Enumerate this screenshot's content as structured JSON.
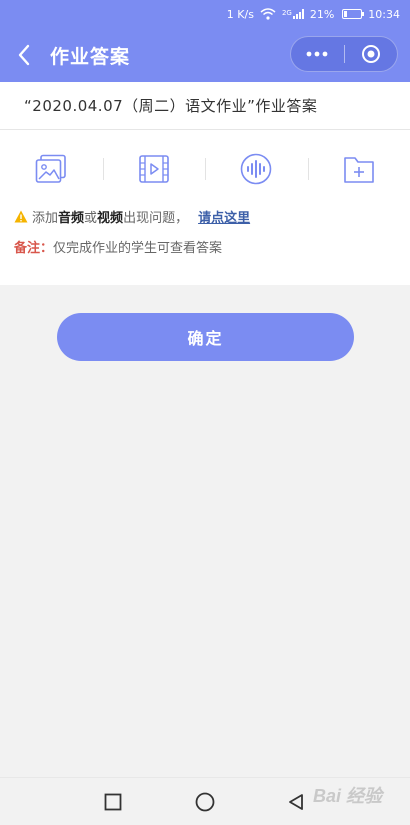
{
  "status_bar": {
    "net_speed": "1 K/s",
    "network_tag": "2G",
    "battery_text": "21%",
    "battery_level": 0.21,
    "time": "10:34"
  },
  "nav": {
    "title": "作业答案",
    "back_icon": "chevron-left-icon",
    "more_icon": "more-dots-icon",
    "close_icon": "target-close-icon"
  },
  "homework": {
    "title": "“2020.04.07（周二）语文作业”作业答案"
  },
  "toolbar": {
    "items": [
      {
        "icon": "image-icon"
      },
      {
        "icon": "video-icon"
      },
      {
        "icon": "audio-icon"
      },
      {
        "icon": "add-file-icon"
      }
    ]
  },
  "notice": {
    "warn_prefix": "添加",
    "warn_audio": "音频",
    "warn_or": "或",
    "warn_video": "视频",
    "warn_suffix": "出现问题，",
    "warn_link": "请点这里",
    "note_label": "备注：",
    "note_text": "仅完成作业的学生可查看答案"
  },
  "confirm_label": "确定",
  "watermark": "Bai 经验",
  "colors": {
    "primary": "#7b8cf2",
    "icon": "#7b8cf2",
    "warn": "#f5b400",
    "note": "#d8574c",
    "link": "#3c5fa8"
  }
}
